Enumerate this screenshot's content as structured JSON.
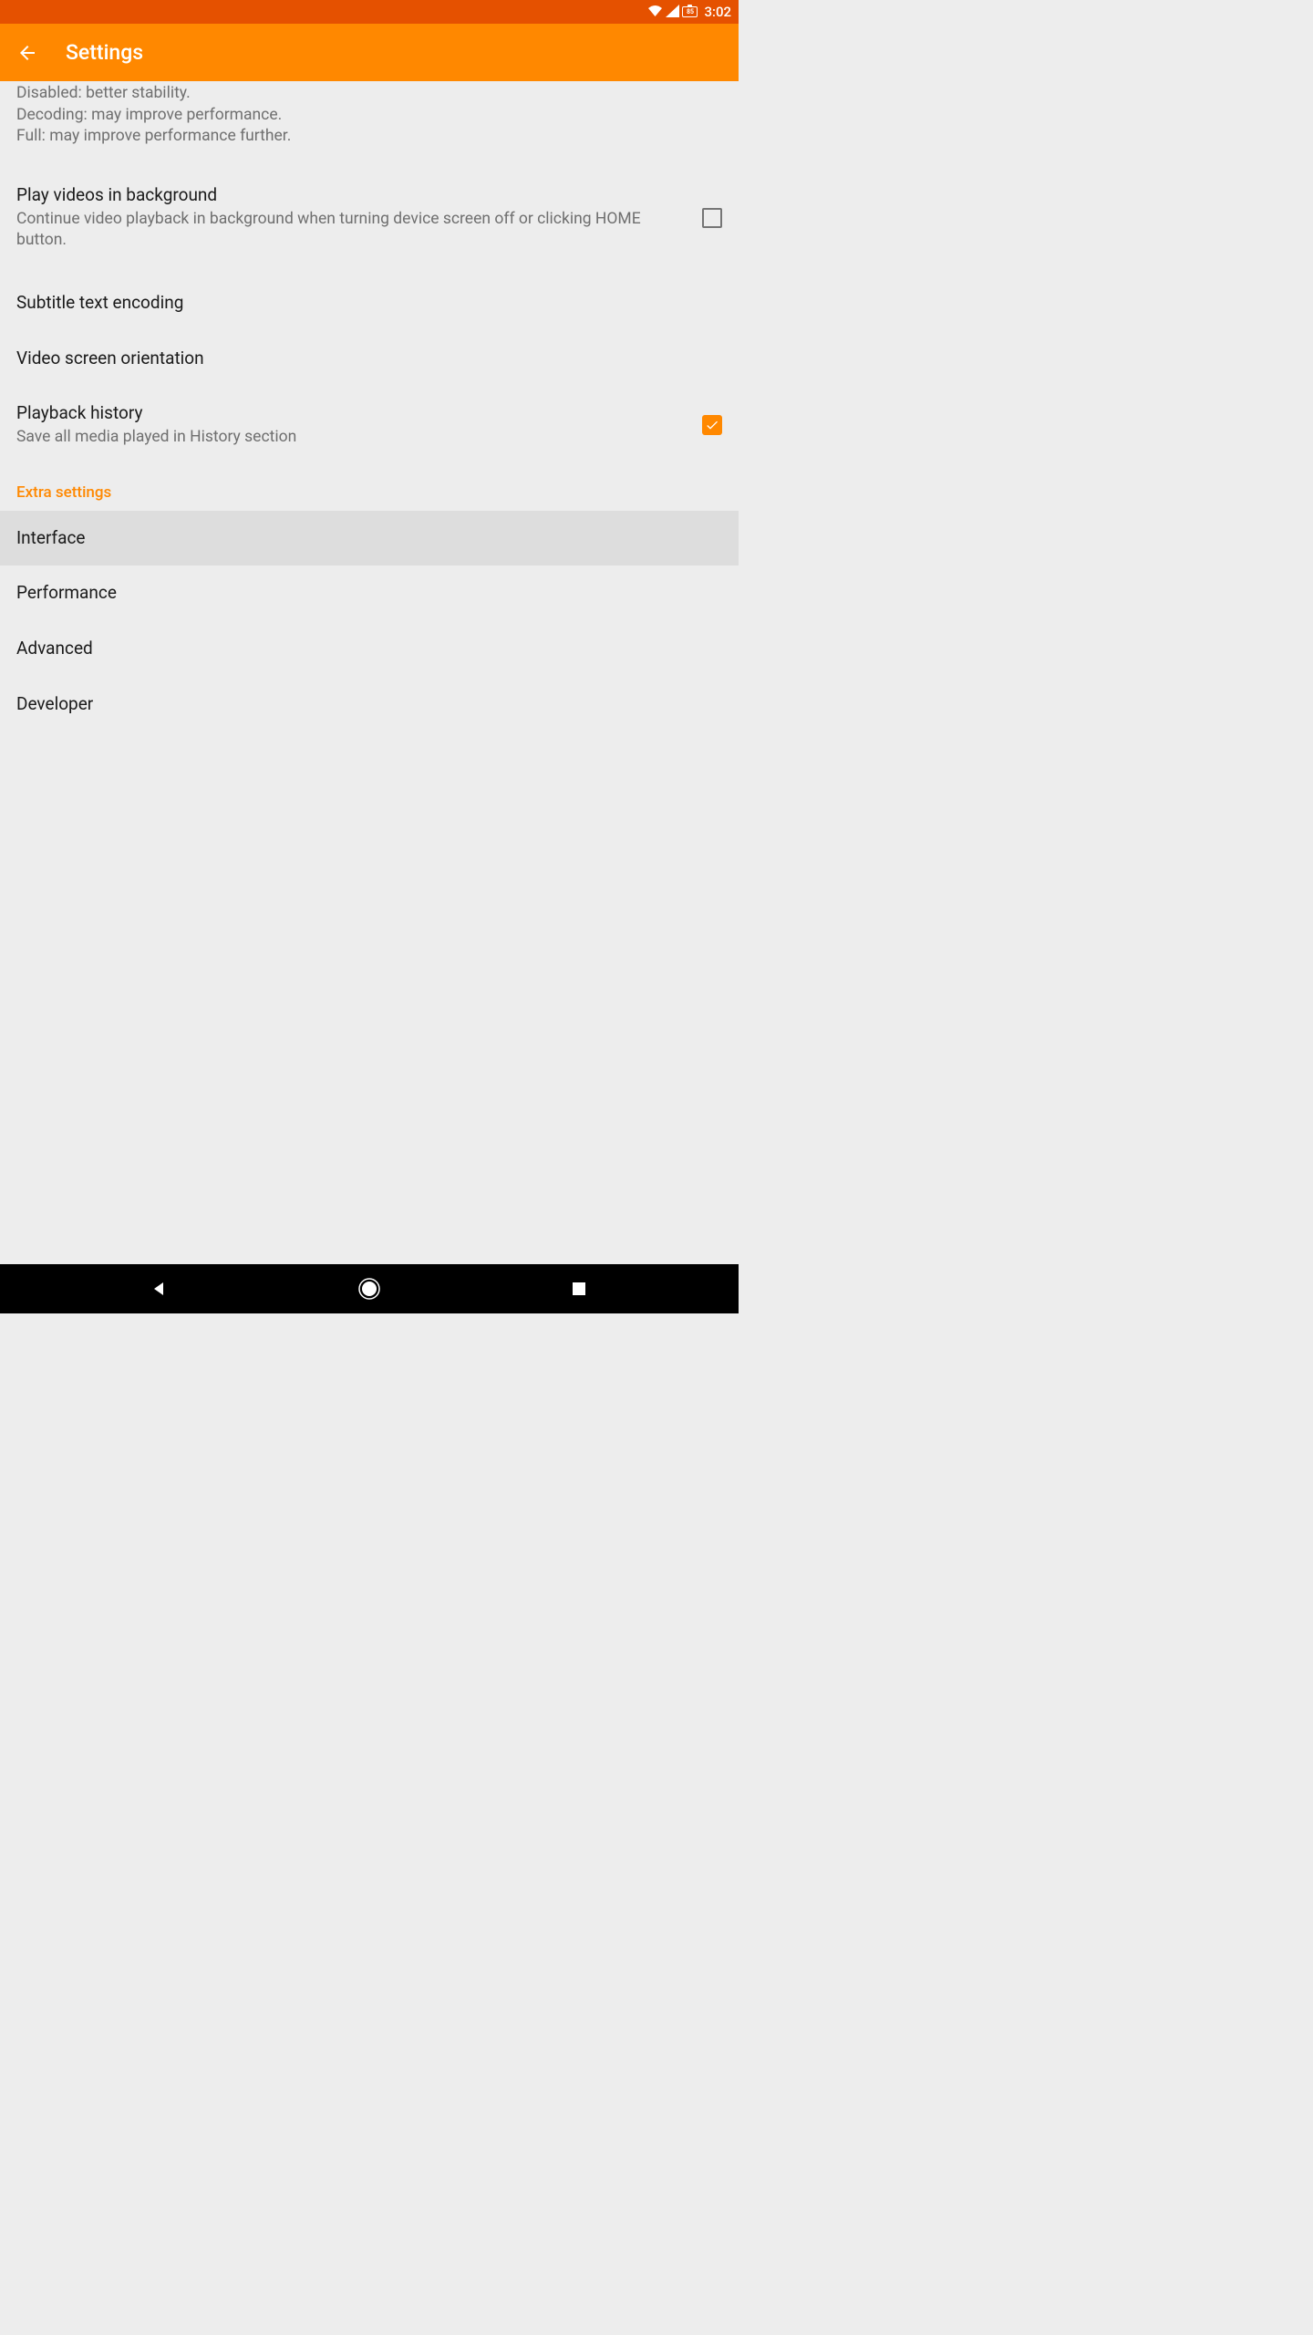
{
  "status": {
    "time": "3:02",
    "battery": "85"
  },
  "header": {
    "title": "Settings"
  },
  "top_desc": {
    "line1": "Disabled: better stability.",
    "line2": "Decoding: may improve performance.",
    "line3": "Full: may improve performance further."
  },
  "items": {
    "background": {
      "title": "Play videos in background",
      "subtitle": "Continue video playback in background when turning device screen off or clicking HOME button."
    },
    "subtitle_encoding": {
      "title": "Subtitle text encoding"
    },
    "video_orientation": {
      "title": "Video screen orientation"
    },
    "playback_history": {
      "title": "Playback history",
      "subtitle": "Save all media played in History section"
    }
  },
  "section": {
    "extra": "Extra settings"
  },
  "extra_items": {
    "interface": "Interface",
    "performance": "Performance",
    "advanced": "Advanced",
    "developer": "Developer"
  }
}
